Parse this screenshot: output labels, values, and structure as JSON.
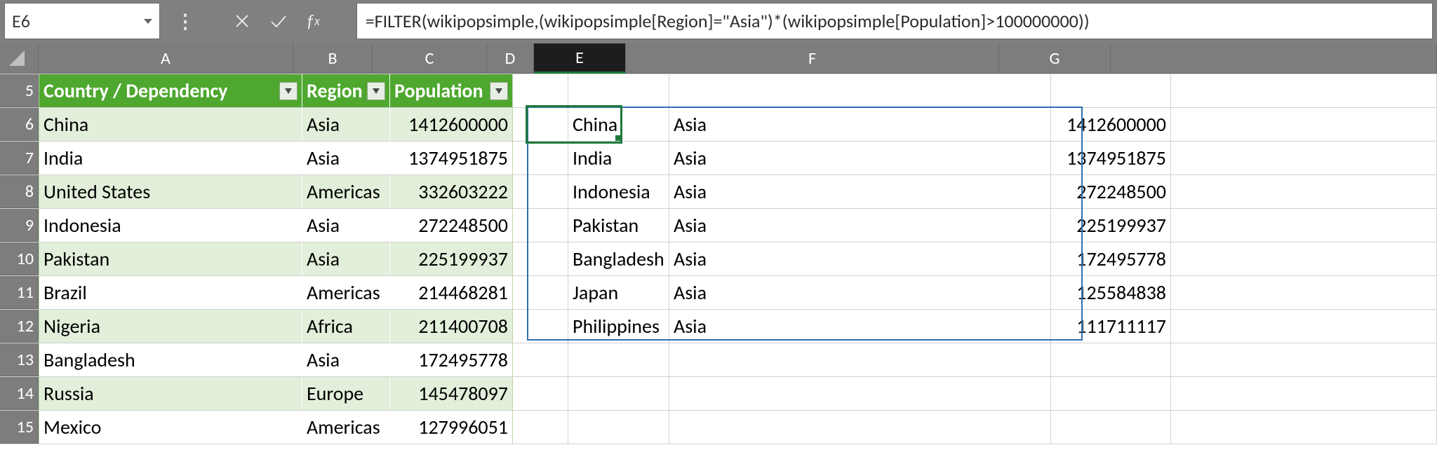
{
  "formula_bar": {
    "name_box": "E6",
    "formula": "=FILTER(wikipopsimple,(wikipopsimple[Region]=\"Asia\")*(wikipopsimple[Population]>100000000))"
  },
  "columns": [
    "A",
    "B",
    "C",
    "D",
    "E",
    "F",
    "G"
  ],
  "active_column": "E",
  "row_start": 5,
  "table_headers": {
    "country": "Country / Dependency",
    "region": "Region",
    "population": "Population"
  },
  "source_rows": [
    {
      "row": 6,
      "country": "China",
      "region": "Asia",
      "population": "1412600000",
      "tint": true
    },
    {
      "row": 7,
      "country": "India",
      "region": "Asia",
      "population": "1374951875",
      "tint": false
    },
    {
      "row": 8,
      "country": "United States",
      "region": "Americas",
      "population": "332603222",
      "tint": true
    },
    {
      "row": 9,
      "country": "Indonesia",
      "region": "Asia",
      "population": "272248500",
      "tint": false
    },
    {
      "row": 10,
      "country": "Pakistan",
      "region": "Asia",
      "population": "225199937",
      "tint": true
    },
    {
      "row": 11,
      "country": "Brazil",
      "region": "Americas",
      "population": "214468281",
      "tint": false
    },
    {
      "row": 12,
      "country": "Nigeria",
      "region": "Africa",
      "population": "211400708",
      "tint": true
    },
    {
      "row": 13,
      "country": "Bangladesh",
      "region": "Asia",
      "population": "172495778",
      "tint": false
    },
    {
      "row": 14,
      "country": "Russia",
      "region": "Europe",
      "population": "145478097",
      "tint": true
    },
    {
      "row": 15,
      "country": "Mexico",
      "region": "Americas",
      "population": "127996051",
      "tint": false
    }
  ],
  "spill_rows": [
    {
      "e": "China",
      "f": "Asia",
      "g": "1412600000"
    },
    {
      "e": "India",
      "f": "Asia",
      "g": "1374951875"
    },
    {
      "e": "Indonesia",
      "f": "Asia",
      "g": "272248500"
    },
    {
      "e": "Pakistan",
      "f": "Asia",
      "g": "225199937"
    },
    {
      "e": "Bangladesh",
      "f": "Asia",
      "g": "172495778"
    },
    {
      "e": "Japan",
      "f": "Asia",
      "g": "125584838"
    },
    {
      "e": "Philippines",
      "f": "Asia",
      "g": "111711117"
    }
  ]
}
